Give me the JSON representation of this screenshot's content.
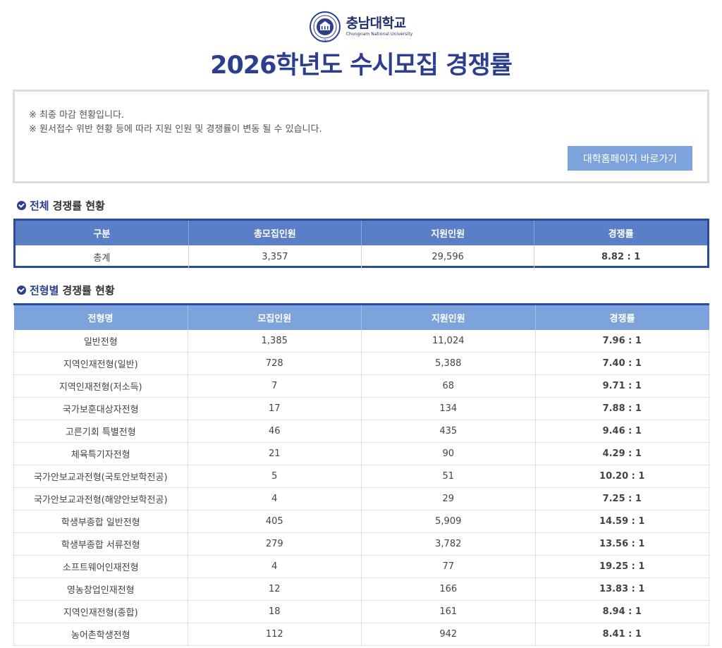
{
  "header": {
    "logo_ko": "충남대학교",
    "logo_en": "Chungnam National University",
    "title": "2026학년도  수시모집  경쟁률"
  },
  "notice": {
    "line1": "※ 최종 마감 현황입니다.",
    "line2": "※ 원서접수 위반 현황 등에 따라 지원 인원 및 경쟁률이 변동 될 수 있습니다.",
    "home_button": "대학홈페이지 바로가기"
  },
  "total_section": {
    "title_accent": "전체",
    "title_rest": "경쟁률 현황",
    "headers": [
      "구분",
      "총모집인원",
      "지원인원",
      "경쟁률"
    ],
    "row": [
      "총계",
      "3,357",
      "29,596",
      "8.82 : 1"
    ]
  },
  "type_section": {
    "title_accent": "전형별",
    "title_rest": "경쟁률 현황",
    "headers": [
      "전형명",
      "모집인원",
      "지원인원",
      "경쟁률"
    ],
    "rows": [
      [
        "일반전형",
        "1,385",
        "11,024",
        "7.96 : 1"
      ],
      [
        "지역인재전형(일반)",
        "728",
        "5,388",
        "7.40 : 1"
      ],
      [
        "지역인재전형(저소득)",
        "7",
        "68",
        "9.71 : 1"
      ],
      [
        "국가보훈대상자전형",
        "17",
        "134",
        "7.88 : 1"
      ],
      [
        "고른기회 특별전형",
        "46",
        "435",
        "9.46 : 1"
      ],
      [
        "체육특기자전형",
        "21",
        "90",
        "4.29 : 1"
      ],
      [
        "국가안보교과전형(국토안보학전공)",
        "5",
        "51",
        "10.20 : 1"
      ],
      [
        "국가안보교과전형(해양안보학전공)",
        "4",
        "29",
        "7.25 : 1"
      ],
      [
        "학생부종합 일반전형",
        "405",
        "5,909",
        "14.59 : 1"
      ],
      [
        "학생부종합 서류전형",
        "279",
        "3,782",
        "13.56 : 1"
      ],
      [
        "소프트웨어인재전형",
        "4",
        "77",
        "19.25 : 1"
      ],
      [
        "영농창업인재전형",
        "12",
        "166",
        "13.83 : 1"
      ],
      [
        "지역인재전형(종합)",
        "18",
        "161",
        "8.94 : 1"
      ],
      [
        "농어촌학생전형",
        "112",
        "942",
        "8.41 : 1"
      ]
    ]
  },
  "colors": {
    "brand_navy": "#2c3f8f",
    "total_header": "#5a7fc6",
    "type_header": "#7ca3db",
    "button": "#7ca3db"
  }
}
